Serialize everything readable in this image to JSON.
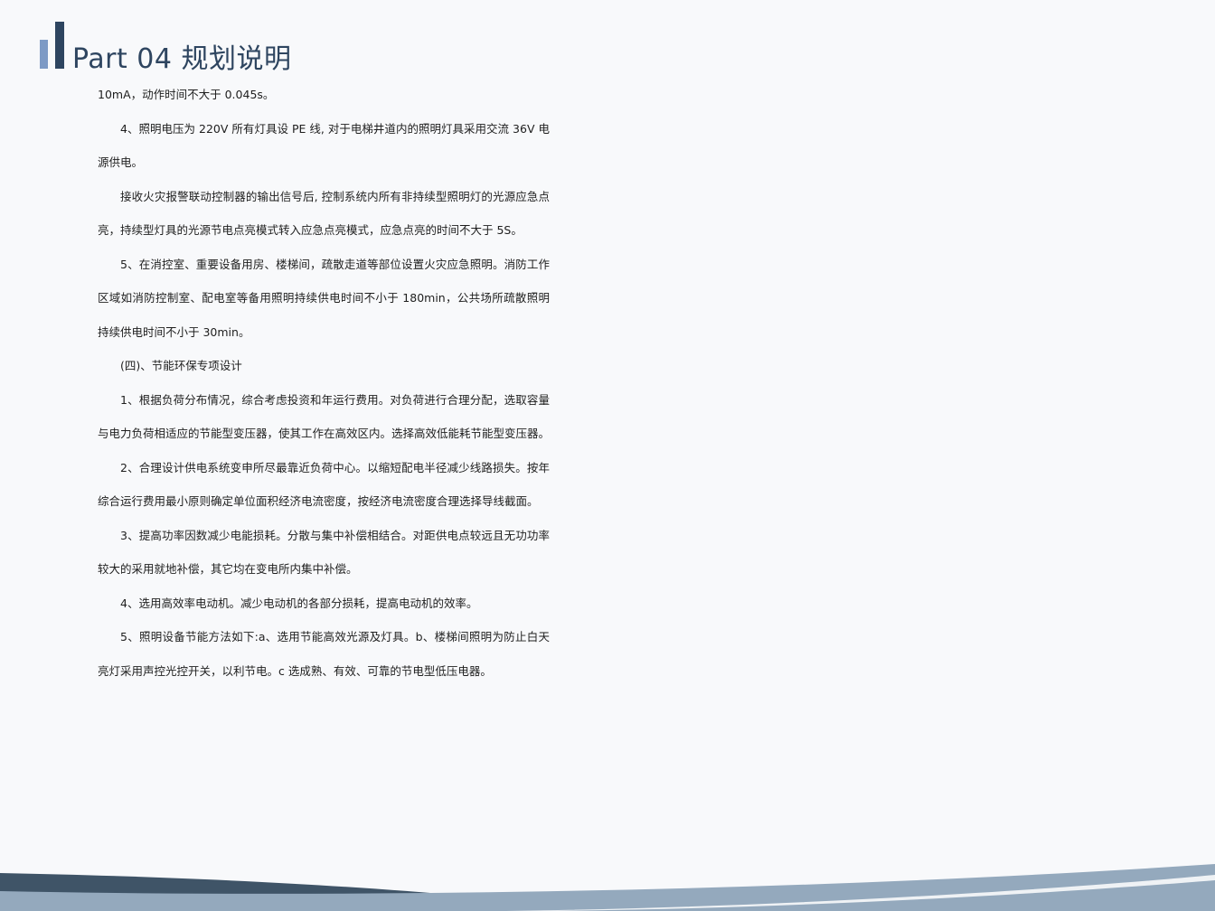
{
  "header": {
    "title": "Part 04  规划说明"
  },
  "paragraphs": [
    {
      "text": "10mA，动作时间不大于 0.045s。",
      "indent": false
    },
    {
      "text": "4、照明电压为 220V 所有灯具设 PE 线, 对于电梯井道内的照明灯具采用交流 36V 电源供电。",
      "indent": true
    },
    {
      "text": "接收火灾报警联动控制器的输出信号后, 控制系统内所有非持续型照明灯的光源应急点亮，持续型灯具的光源节电点亮模式转入应急点亮模式，应急点亮的时间不大于 5S。",
      "indent": true
    },
    {
      "text": "5、在消控室、重要设备用房、楼梯间，疏散走道等部位设置火灾应急照明。消防工作区域如消防控制室、配电室等备用照明持续供电时间不小于 180min，公共场所疏散照明持续供电时间不小于 30min。",
      "indent": true
    },
    {
      "text": "(四)、节能环保专项设计",
      "indent": true
    },
    {
      "text": "1、根据负荷分布情况，综合考虑投资和年运行费用。对负荷进行合理分配，选取容量与电力负荷相适应的节能型变压器，使其工作在高效区内。选择高效低能耗节能型变压器。",
      "indent": true
    },
    {
      "text": "2、合理设计供电系统变申所尽最靠近负荷中心。以缩短配电半径减少线路损失。按年综合运行费用最小原则确定单位面积经济电流密度，按经济电流密度合理选择导线截面。",
      "indent": true
    },
    {
      "text": "3、提高功率因数减少电能损耗。分散与集中补偿相结合。对距供电点较远且无功功率较大的采用就地补偿，其它均在变电所内集中补偿。",
      "indent": true
    },
    {
      "text": "4、选用高效率电动机。减少电动机的各部分损耗，提高电动机的效率。",
      "indent": true
    },
    {
      "text": "5、照明设备节能方法如下:a、选用节能高效光源及灯具。b、楼梯间照明为防止白天亮灯采用声控光控开关，以利节电。c 选成熟、有效、可靠的节电型低压电器。",
      "indent": true
    }
  ],
  "colors": {
    "accent_dark": "#2e4560",
    "accent_light": "#7d9ac5",
    "wave_dark": "#3f5467",
    "wave_light": "#94a9bd"
  }
}
